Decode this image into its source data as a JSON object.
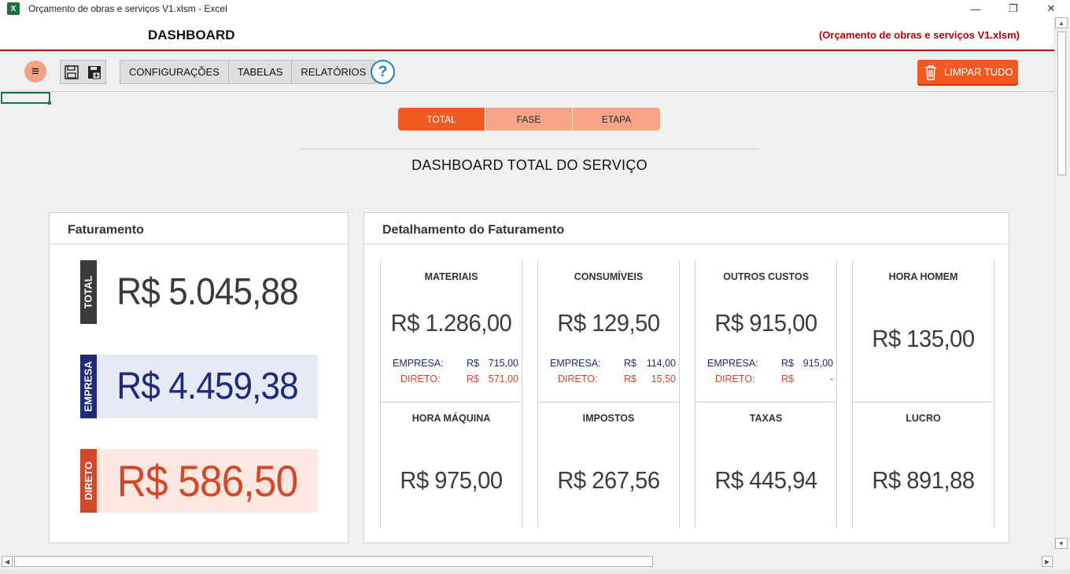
{
  "window": {
    "title": "Orçamento de obras e serviços V1.xlsm - Excel",
    "icon": "excel-icon",
    "controls": {
      "minimize": "—",
      "restore": "❐",
      "close": "✕"
    }
  },
  "header": {
    "title": "DASHBOARD",
    "file": "(Orçamento de obras e serviços V1.xlsm)"
  },
  "toolbar": {
    "menu_icon": "≡",
    "nav": [
      "CONFIGURAÇÕES",
      "TABELAS",
      "RELATÓRIOS"
    ],
    "help": "?",
    "clear_label": "LIMPAR TUDO"
  },
  "tabs": [
    "TOTAL",
    "FASE",
    "ETAPA"
  ],
  "section_title": "DASHBOARD TOTAL  DO SERVIÇO",
  "faturamento": {
    "title": "Faturamento",
    "rows": [
      {
        "label": "TOTAL",
        "value": "R$ 5.045,88"
      },
      {
        "label": "EMPRESA",
        "value": "R$ 4.459,38"
      },
      {
        "label": "DIRETO",
        "value": "R$ 586,50"
      }
    ]
  },
  "detalhamento": {
    "title": "Detalhamento do Faturamento",
    "cards": [
      {
        "title": "MATERIAIS",
        "value": "R$ 1.286,00",
        "empresa_label": "EMPRESA:",
        "empresa_cur": "R$",
        "empresa": "715,00",
        "direto_label": "DIRETO:",
        "direto_cur": "R$",
        "direto": "571,00"
      },
      {
        "title": "CONSUMÍVEIS",
        "value": "R$ 129,50",
        "empresa_label": "EMPRESA:",
        "empresa_cur": "R$",
        "empresa": "114,00",
        "direto_label": "DIRETO:",
        "direto_cur": "R$",
        "direto": "15,50"
      },
      {
        "title": "OUTROS CUSTOS",
        "value": "R$ 915,00",
        "empresa_label": "EMPRESA:",
        "empresa_cur": "R$",
        "empresa": "915,00",
        "direto_label": "DIRETO:",
        "direto_cur": "R$",
        "direto": "-"
      },
      {
        "title": "HORA HOMEM",
        "value": "R$ 135,00"
      },
      {
        "title": "HORA MÁQUINA",
        "value": "R$ 975,00"
      },
      {
        "title": "IMPOSTOS",
        "value": "R$ 267,56"
      },
      {
        "title": "TAXAS",
        "value": "R$ 445,94"
      },
      {
        "title": "LUCRO",
        "value": "R$ 891,88"
      }
    ]
  }
}
